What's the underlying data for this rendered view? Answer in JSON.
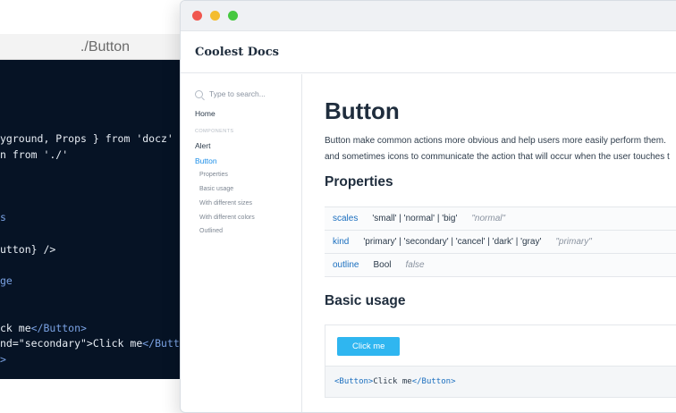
{
  "editor": {
    "title": "./Button",
    "lines": [
      {
        "plain": "yground, Props } from 'docz'"
      },
      {
        "plain": "n from './'"
      },
      {
        "blue": "s"
      },
      {
        "plain": "utton} />"
      },
      {
        "blue": "ge"
      },
      {
        "plain_a": "ck me",
        "blue_a": "</Button>"
      },
      {
        "plain_a": "nd=\"secondary\">Click me",
        "blue_a": "</Button>"
      },
      {
        "blue": ">"
      }
    ]
  },
  "docs": {
    "brand": "Coolest Docs",
    "search_placeholder": "Type to search...",
    "nav": {
      "home": "Home",
      "section": "COMPONENTS",
      "alert": "Alert",
      "button": "Button",
      "subitems": [
        "Properties",
        "Basic usage",
        "With different sizes",
        "With different colors",
        "Outlined"
      ]
    },
    "title": "Button",
    "lead_1": "Button make common actions more obvious and help users more easily perform them.",
    "lead_2": "and sometimes icons to communicate the action that will occur when the user touches t",
    "properties_heading": "Properties",
    "props": [
      {
        "name": "scales",
        "type": "'small'  |  'normal'  |  'big'",
        "default": "\"normal\""
      },
      {
        "name": "kind",
        "type": "'primary'  |  'secondary'  |  'cancel'  |  'dark'  |  'gray'",
        "default": "\"primary\""
      },
      {
        "name": "outline",
        "type": "Bool",
        "default": "false"
      }
    ],
    "basic_usage_heading": "Basic usage",
    "demo_button": "Click me",
    "demo_code": {
      "open": "<Button>",
      "text": "Click me",
      "close": "</Button>"
    }
  }
}
